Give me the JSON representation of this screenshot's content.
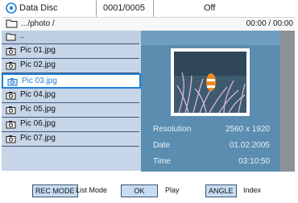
{
  "top_bar": {
    "disc_label": "Data Disc",
    "track_counter": "0001/0005",
    "repeat_mode": "Off"
  },
  "path_bar": {
    "path": ".../photo /",
    "elapsed": "00:00 / 00:00"
  },
  "files": [
    {
      "name": "..",
      "type": "folder",
      "selected": false
    },
    {
      "name": "Pic 01.jpg",
      "type": "photo",
      "selected": false
    },
    {
      "name": "Pic 02.jpg",
      "type": "photo",
      "selected": false
    },
    {
      "name": "Pic 03.jpg",
      "type": "photo",
      "selected": true
    },
    {
      "name": "Pic 04.jpg",
      "type": "photo",
      "selected": false
    },
    {
      "name": "Pic 05.jpg",
      "type": "photo",
      "selected": false
    },
    {
      "name": "Pic 06.jpg",
      "type": "photo",
      "selected": false
    },
    {
      "name": "Pic 07.jpg",
      "type": "photo",
      "selected": false
    }
  ],
  "info": {
    "resolution_label": "Resolution",
    "resolution_value": "2560 x 1920",
    "date_label": "Date",
    "date_value": "01.02.2005",
    "time_label": "Time",
    "time_value": "03:10:50"
  },
  "help": [
    {
      "key": "REC MODE",
      "action": "List Mode"
    },
    {
      "key": "OK",
      "action": "Play"
    },
    {
      "key": "ANGLE",
      "action": "Index"
    }
  ],
  "colors": {
    "selected_border": "#1f7fd8",
    "list_bg": "#c6d5e8",
    "preview_bg": "#5b8db0"
  },
  "icons": {
    "disc": "disc-icon",
    "folder": "folder-icon",
    "photo": "camera-icon"
  }
}
